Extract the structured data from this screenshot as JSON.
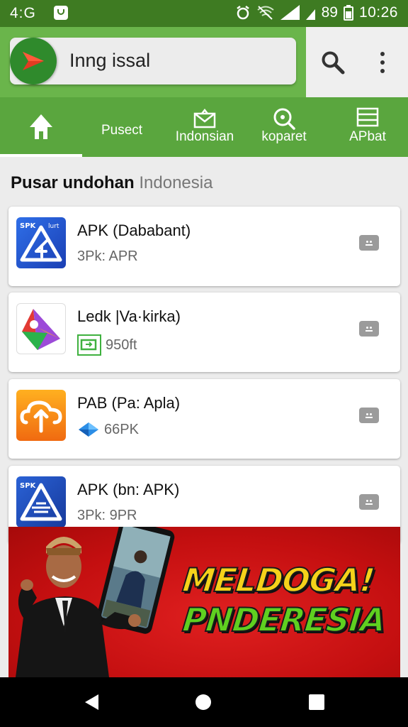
{
  "status_bar": {
    "left_text": "4:G",
    "battery": "89",
    "time": "10:26"
  },
  "search": {
    "query": "Inng issal"
  },
  "tabs": [
    {
      "label": ""
    },
    {
      "label": "Pusect"
    },
    {
      "label": "Indonsian"
    },
    {
      "label": "koparet"
    },
    {
      "label": "APbat"
    }
  ],
  "section": {
    "title": "Pusar undohan",
    "region": "Indonesia"
  },
  "apps": [
    {
      "name": "APK (Dababant)",
      "subtitle": "3Pk: APR",
      "icon": "apk-triangle-icon",
      "icon_label": "SPK",
      "icon_label2": "lurt"
    },
    {
      "name": "Ledk |Va·kirka)",
      "subtitle": "950ft",
      "icon": "colorful-triangle-icon"
    },
    {
      "name": "PAB (Pa: Apla)",
      "subtitle": "66PK",
      "icon": "orange-cloud-icon"
    },
    {
      "name": "APK (bn: APK)",
      "subtitle": "3Pk: 9PR",
      "icon": "apk-document-icon",
      "icon_label": "SPK"
    }
  ],
  "banner": {
    "line1": "MELDOGA!",
    "line2": "PNDERESIA"
  },
  "colors": {
    "status_bar": "#3e7b22",
    "header": "#6ab54b",
    "tab_bar": "#5aa63e",
    "banner_red": "#c40f10",
    "headline_yellow": "#f5d21a",
    "headline_green": "#5fd020"
  }
}
